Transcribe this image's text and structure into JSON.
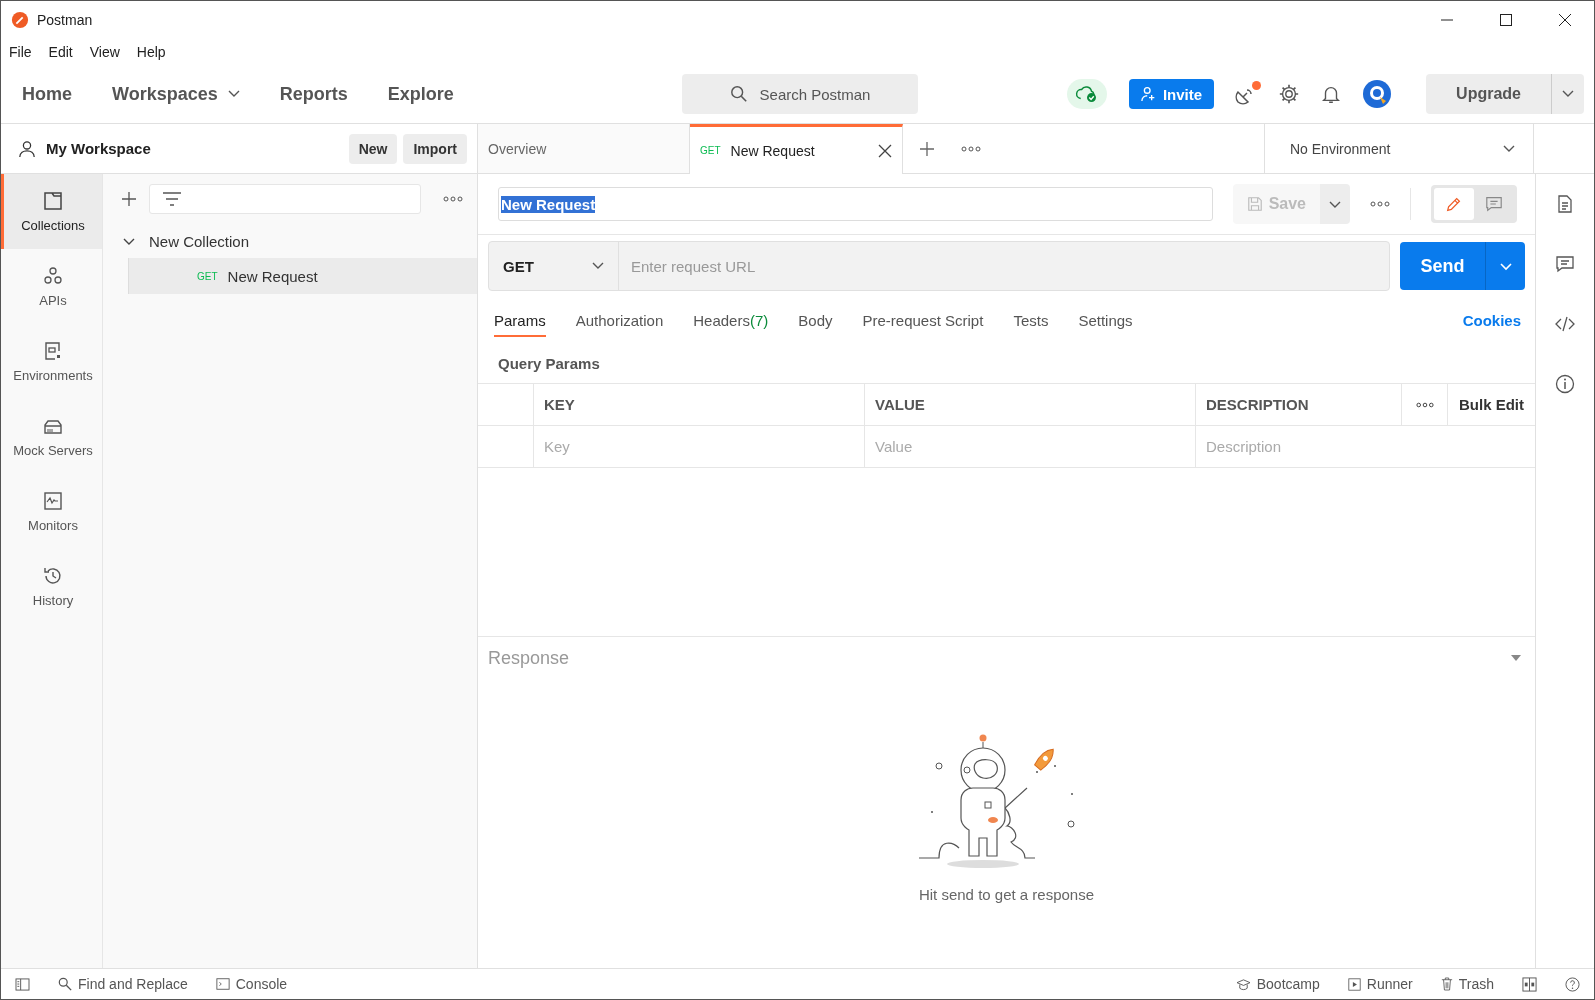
{
  "window": {
    "title": "Postman"
  },
  "menu": [
    "File",
    "Edit",
    "View",
    "Help"
  ],
  "nav": [
    {
      "label": "Home",
      "kind": "link"
    },
    {
      "label": "Workspaces",
      "kind": "dropdown"
    },
    {
      "label": "Reports",
      "kind": "link"
    },
    {
      "label": "Explore",
      "kind": "link"
    }
  ],
  "search": {
    "placeholder": "Search Postman"
  },
  "header": {
    "invite": "Invite",
    "upgrade": "Upgrade",
    "notification_dot": true
  },
  "workspace": {
    "name": "My Workspace",
    "buttons": [
      "New",
      "Import"
    ]
  },
  "sidebar": {
    "items": [
      {
        "label": "Collections",
        "kind": "collections",
        "selected": true
      },
      {
        "label": "APIs",
        "kind": "apis",
        "selected": false
      },
      {
        "label": "Environments",
        "kind": "environments",
        "selected": false
      },
      {
        "label": "Mock Servers",
        "kind": "mock",
        "selected": false
      },
      {
        "label": "Monitors",
        "kind": "monitors",
        "selected": false
      },
      {
        "label": "History",
        "kind": "history",
        "selected": false
      }
    ]
  },
  "collections": [
    {
      "name": "New Collection",
      "expanded": true,
      "children": [
        {
          "method": "GET",
          "name": "New Request",
          "selected": true
        }
      ]
    }
  ],
  "tabs": [
    {
      "label": "Overview",
      "selected": false
    },
    {
      "method": "GET",
      "label": "New Request",
      "selected": true
    }
  ],
  "environment": "No Environment",
  "view_modes": [
    {
      "kind": "edit",
      "selected": true
    },
    {
      "kind": "comments",
      "selected": false
    }
  ],
  "request": {
    "name": "New Request",
    "name_highlighted": true,
    "save": "Save",
    "method": "GET",
    "url_placeholder": "Enter request URL",
    "send": "Send"
  },
  "request_tabs": [
    {
      "label": "Params",
      "selected": true
    },
    {
      "label": "Authorization",
      "selected": false
    },
    {
      "label": "Headers",
      "count": "(7)",
      "selected": false
    },
    {
      "label": "Body",
      "selected": false
    },
    {
      "label": "Pre-request Script",
      "selected": false
    },
    {
      "label": "Tests",
      "selected": false
    },
    {
      "label": "Settings",
      "selected": false
    }
  ],
  "cookies": "Cookies",
  "query_params": {
    "title": "Query Params",
    "columns": [
      "KEY",
      "VALUE",
      "DESCRIPTION"
    ],
    "bulk_edit": "Bulk Edit",
    "placeholders": [
      "Key",
      "Value",
      "Description"
    ]
  },
  "response": {
    "title": "Response",
    "hint": "Hit send to get a response"
  },
  "status_bar": {
    "left": [
      {
        "kind": "find",
        "label": "Find and Replace"
      },
      {
        "kind": "console",
        "label": "Console"
      }
    ],
    "right": [
      {
        "kind": "bootcamp",
        "label": "Bootcamp"
      },
      {
        "kind": "runner",
        "label": "Runner"
      },
      {
        "kind": "trash",
        "label": "Trash"
      }
    ]
  }
}
